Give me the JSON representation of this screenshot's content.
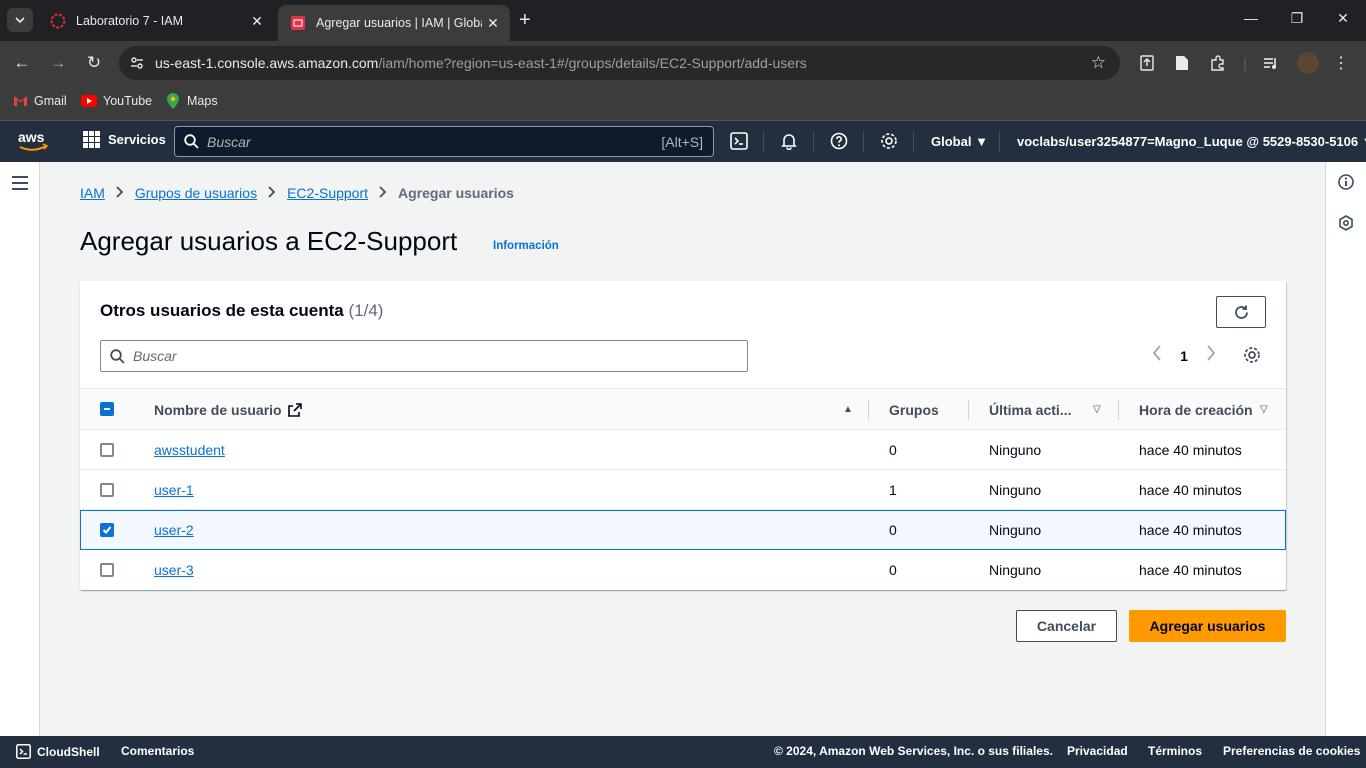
{
  "browser": {
    "tabs": [
      {
        "title": "Laboratorio 7 - IAM",
        "active": false
      },
      {
        "title": "Agregar usuarios | IAM | Global",
        "active": true
      }
    ],
    "url_host": "us-east-1.console.aws.amazon.com",
    "url_path": "/iam/home?region=us-east-1#/groups/details/EC2-Support/add-users",
    "bookmarks": [
      "Gmail",
      "YouTube",
      "Maps"
    ]
  },
  "aws_nav": {
    "services_label": "Servicios",
    "search_placeholder": "Buscar",
    "search_shortcut": "[Alt+S]",
    "region": "Global",
    "account": "voclabs/user3254877=Magno_Luque @ 5529-8530-5106"
  },
  "breadcrumb": [
    "IAM",
    "Grupos de usuarios",
    "EC2-Support",
    "Agregar usuarios"
  ],
  "page": {
    "title": "Agregar usuarios a EC2-Support",
    "info_link": "Información"
  },
  "table": {
    "title": "Otros usuarios de esta cuenta",
    "count": "(1/4)",
    "search_placeholder": "Buscar",
    "page_number": "1",
    "columns": [
      "Nombre de usuario",
      "Grupos",
      "Última acti...",
      "Hora de creación"
    ],
    "rows": [
      {
        "name": "awsstudent",
        "groups": "0",
        "last_activity": "Ninguno",
        "created": "hace 40 minutos",
        "selected": false
      },
      {
        "name": "user-1",
        "groups": "1",
        "last_activity": "Ninguno",
        "created": "hace 40 minutos",
        "selected": false
      },
      {
        "name": "user-2",
        "groups": "0",
        "last_activity": "Ninguno",
        "created": "hace 40 minutos",
        "selected": true
      },
      {
        "name": "user-3",
        "groups": "0",
        "last_activity": "Ninguno",
        "created": "hace 40 minutos",
        "selected": false
      }
    ]
  },
  "actions": {
    "cancel": "Cancelar",
    "primary": "Agregar usuarios"
  },
  "footer": {
    "cloudshell": "CloudShell",
    "feedback": "Comentarios",
    "copyright": "© 2024, Amazon Web Services, Inc. o sus filiales.",
    "privacy": "Privacidad",
    "terms": "Términos",
    "cookies": "Preferencias de cookies"
  },
  "colors": {
    "aws_nav": "#232f3e",
    "link": "#0972d3",
    "primary_button": "#ff9900"
  }
}
